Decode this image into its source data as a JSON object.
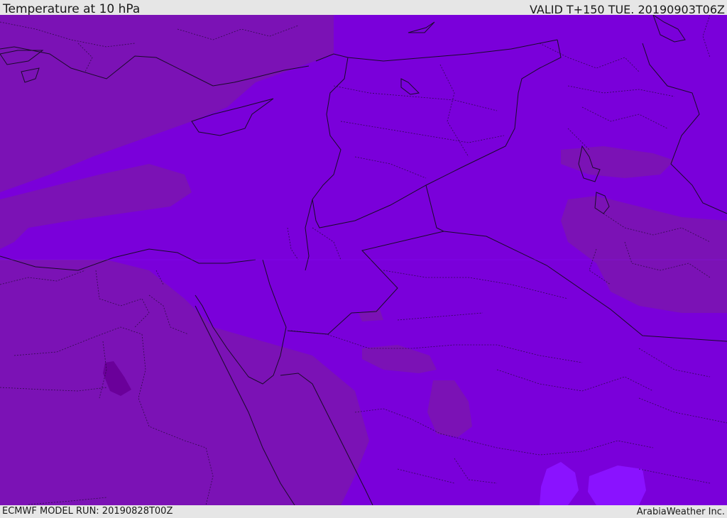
{
  "header": {
    "title": "Temperature at 10 hPa",
    "valid_time": "VALID T+150 TUE. 20190903T06Z"
  },
  "footer": {
    "model_run": "ECMWF MODEL RUN: 20190828T00Z",
    "credit": "ArabiaWeather Inc."
  },
  "map": {
    "colors": {
      "base_fill": "#7a00da",
      "warmer_band": "#7b12b5",
      "warmest_spot": "#6a009a",
      "cooler_band": "#8a12ff",
      "border_line": "#1a0a2a"
    }
  }
}
